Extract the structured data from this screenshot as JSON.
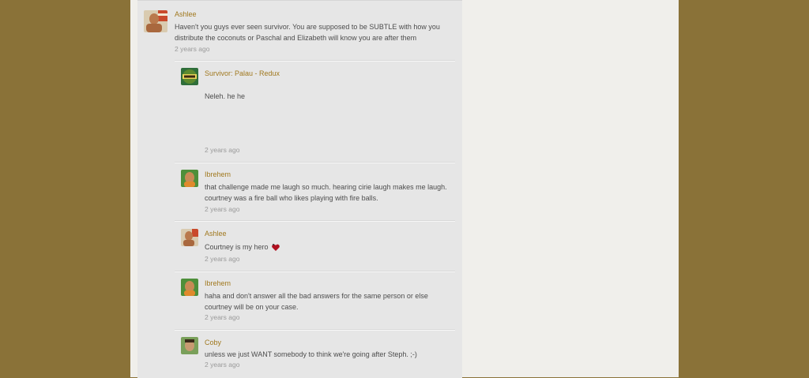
{
  "comments": [
    {
      "author": "Ashlee",
      "lines": [
        "Haven't you guys ever seen survivor.  You are supposed to be SUBTLE with how you",
        "distribute the coconuts or Paschal and Elizabeth will know you are after them"
      ],
      "time": "2 years ago",
      "avatar": "ashlee-avatar"
    },
    {
      "author": "Survivor: Palau - Redux",
      "lines": [
        "Neleh.  he he"
      ],
      "time": "2 years ago",
      "avatar": "survivor-logo-avatar"
    },
    {
      "author": "Ibrehem",
      "lines": [
        "that challenge made me laugh so much. hearing cirie laugh makes me laugh.",
        "courtney was a fire ball who likes playing with fire balls."
      ],
      "time": "2 years ago",
      "avatar": "ibrehem-avatar"
    },
    {
      "author": "Ashlee",
      "lines": [
        "Courtney is my hero"
      ],
      "time": "2 years ago",
      "avatar": "ashlee-avatar",
      "emoji": "heart-emoticon"
    },
    {
      "author": "Ibrehem",
      "lines": [
        "haha and don't answer all the bad answers for the same person or else",
        "courtney will be on your case."
      ],
      "time": "2 years ago",
      "avatar": "ibrehem-avatar"
    },
    {
      "author": "Coby",
      "lines": [
        "unless we just WANT somebody to think we're going after Steph.  ;-)"
      ],
      "time": "2 years ago",
      "avatar": "coby-avatar"
    }
  ],
  "colors": {
    "outer_background": "#8a7238",
    "page_background": "#f0efeb",
    "comment_panel": "#e6e6e6",
    "author_link": "#a0781e",
    "text": "#4d4d4d",
    "timestamp": "#9a9a9a"
  }
}
